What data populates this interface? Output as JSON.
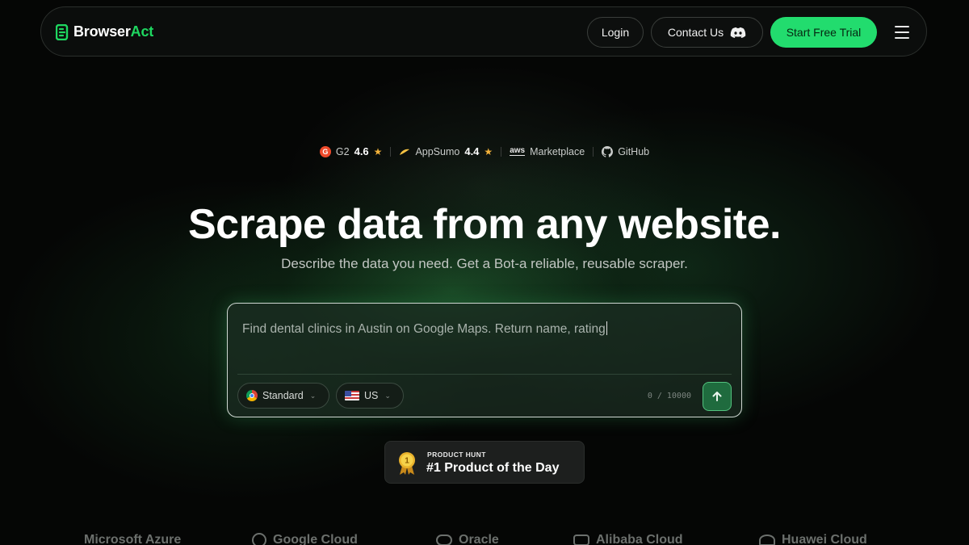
{
  "header": {
    "logo_part1": "Browser",
    "logo_part2": "Act",
    "login_label": "Login",
    "contact_label": "Contact Us",
    "trial_label": "Start Free Trial"
  },
  "badges": {
    "g2_label": "G2",
    "g2_score": "4.6",
    "appsumo_label": "AppSumo",
    "appsumo_score": "4.4",
    "aws_label": "aws",
    "marketplace_label": "Marketplace",
    "github_label": "GitHub"
  },
  "hero": {
    "title": "Scrape data from any website.",
    "subtitle": "Describe the data you need. Get a Bot-a reliable, reusable scraper."
  },
  "prompt": {
    "value": "Find dental clinics in Austin on Google Maps. Return name, rating",
    "browser_mode": "Standard",
    "region": "US",
    "counter": "0 / 10000"
  },
  "product_hunt": {
    "eyebrow": "PRODUCT HUNT",
    "title": "#1 Product of the Day",
    "medal_number": "1"
  },
  "clouds": [
    "Microsoft Azure",
    "Google Cloud",
    "Oracle",
    "Alibaba Cloud",
    "Huawei Cloud"
  ],
  "colors": {
    "accent": "#22dc6e",
    "background": "#050605",
    "star": "#f2b13a"
  }
}
